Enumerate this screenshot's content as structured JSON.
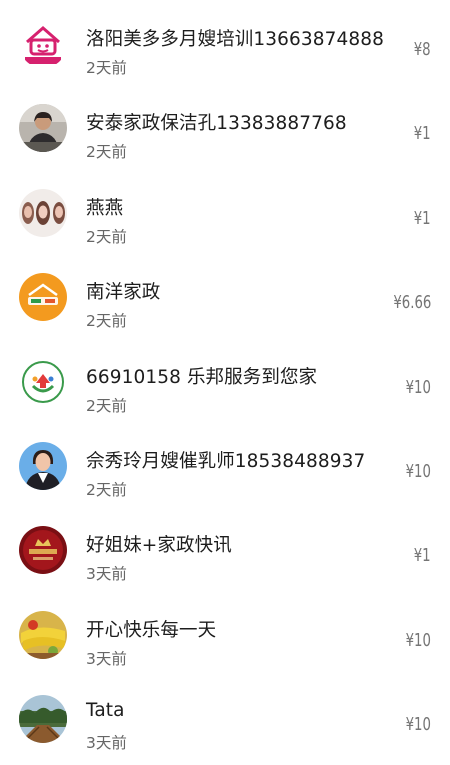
{
  "rows": [
    {
      "name": "洛阳美多多月嫂培训13663874888",
      "time": "2天前",
      "amount": "¥8",
      "avatar": "house-logo-avatar"
    },
    {
      "name": "安泰家政保洁孔13383887768",
      "time": "2天前",
      "amount": "¥1",
      "avatar": "person-photo-avatar"
    },
    {
      "name": "燕燕",
      "time": "2天前",
      "amount": "¥1",
      "avatar": "group-photo-avatar"
    },
    {
      "name": "南洋家政",
      "time": "2天前",
      "amount": "¥6.66",
      "avatar": "orange-logo-avatar"
    },
    {
      "name": "66910158 乐邦服务到您家",
      "time": "2天前",
      "amount": "¥10",
      "avatar": "green-badge-avatar"
    },
    {
      "name": "佘秀玲月嫂催乳师18538488937",
      "time": "2天前",
      "amount": "¥10",
      "avatar": "woman-photo-avatar"
    },
    {
      "name": "好姐妹+家政快讯",
      "time": "3天前",
      "amount": "¥1",
      "avatar": "red-crown-avatar"
    },
    {
      "name": "开心快乐每一天",
      "time": "3天前",
      "amount": "¥10",
      "avatar": "fruit-photo-avatar"
    },
    {
      "name": "Tata",
      "time": "3天前",
      "amount": "¥10",
      "avatar": "landscape-photo-avatar"
    }
  ]
}
